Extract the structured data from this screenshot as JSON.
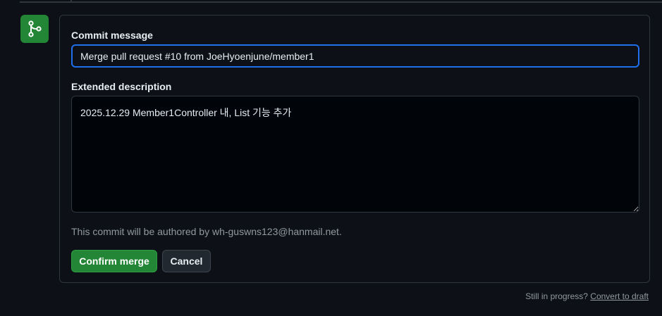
{
  "merge_form": {
    "commit_message_label": "Commit message",
    "commit_message_value": "Merge pull request #10 from JoeHyoenjune/member1",
    "extended_description_label": "Extended description",
    "extended_description_value": "2025.12.29 Member1Controller 내, List 기능 추가",
    "author_note": "This commit will be authored by wh-guswns123@hanmail.net.",
    "confirm_label": "Confirm merge",
    "cancel_label": "Cancel"
  },
  "footer": {
    "prompt": "Still in progress?",
    "convert_link": "Convert to draft"
  },
  "icons": {
    "merge_badge": "git-merge-icon"
  },
  "colors": {
    "accent_green": "#238636",
    "focus_blue": "#1f6feb",
    "background": "#0d1117"
  }
}
